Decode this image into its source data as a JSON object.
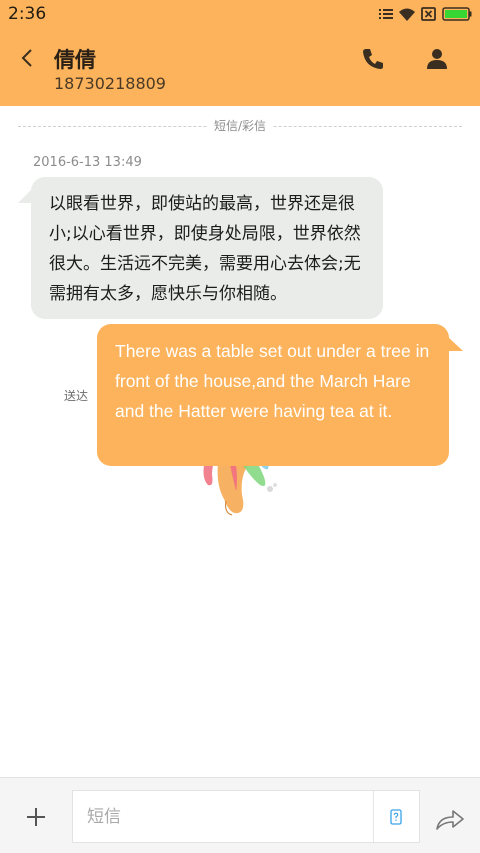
{
  "status_bar": {
    "time": "2:36"
  },
  "header": {
    "contact_name": "倩倩",
    "phone_number": "18730218809"
  },
  "thread": {
    "divider_label": "短信/彩信",
    "timestamp": "2016-6-13 13:49",
    "received_message": "以眼看世界，即使站的最高，世界还是很小;以心看世界，即使身处局限，世界依然很大。生活远不完美，需要用心去体会;无需拥有太多，愿快乐与你相随。",
    "sent_message": "There was a table set out under a tree in front of the house,and the March Hare and the Hatter were having tea at it.",
    "send_status": "送达"
  },
  "composer": {
    "placeholder": "短信"
  },
  "colors": {
    "accent": "#fdb35b",
    "received_bubble": "#e9ece8",
    "background": "#ffffff"
  },
  "icons": {
    "back": "chevron-left-icon",
    "call": "phone-icon",
    "contact": "person-icon",
    "add": "plus-icon",
    "sms_type": "sms-type-icon",
    "send": "send-arrow-icon"
  }
}
